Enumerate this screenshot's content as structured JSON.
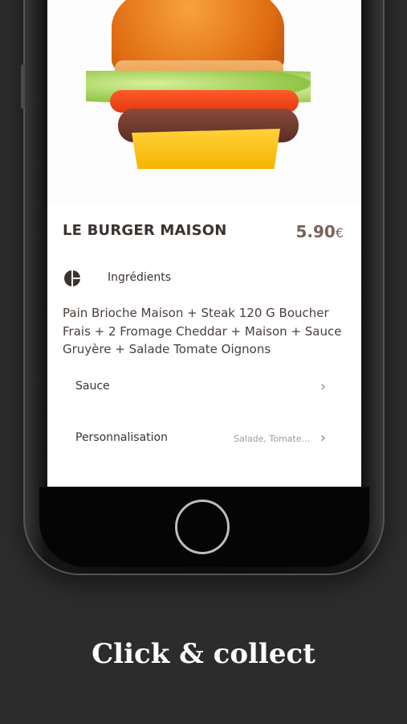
{
  "product": {
    "title": "LE BURGER MAISON",
    "price_value": "5.90",
    "currency": "€"
  },
  "ingredients": {
    "label": "Ingrédients",
    "text": "Pain Brioche Maison  + Steak 120 G Boucher Frais +  2 Fromage Cheddar + Maison + Sauce Gruyère + Salade Tomate Oignons"
  },
  "options": [
    {
      "label": "Sauce",
      "value": ""
    },
    {
      "label": "Personnalisation",
      "value": "Salade, Tomate..."
    }
  ],
  "caption": "Click & collect",
  "icons": {
    "ingredients": "ingredients-icon",
    "chevron": "chevron-right-icon"
  },
  "colors": {
    "background": "#2c2c2c",
    "title": "#3a3330",
    "price": "#7a6258"
  }
}
